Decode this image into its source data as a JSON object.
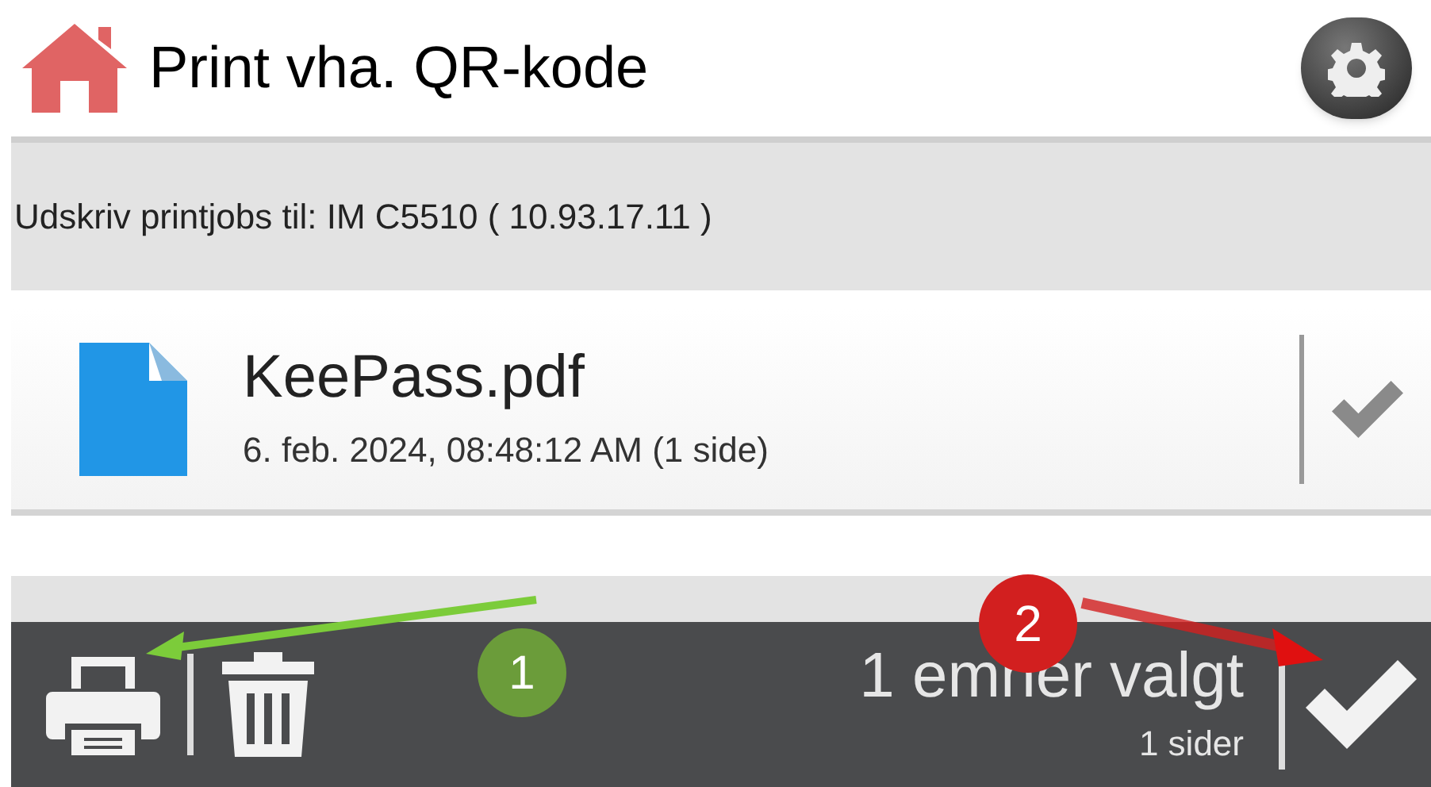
{
  "header": {
    "title": "Print vha. QR-kode"
  },
  "destination": "Udskriv printjobs til: IM C5510 ( 10.93.17.11 )",
  "files": [
    {
      "name": "KeePass.pdf",
      "details": "6. feb. 2024, 08:48:12 AM (1 side)",
      "selected": true
    }
  ],
  "toolbar": {
    "selection_count": "1 emner valgt",
    "pages": "1 sider"
  },
  "annotations": [
    {
      "label": "1",
      "color": "#6b9c3a"
    },
    {
      "label": "2",
      "color": "#d21f1f"
    }
  ]
}
